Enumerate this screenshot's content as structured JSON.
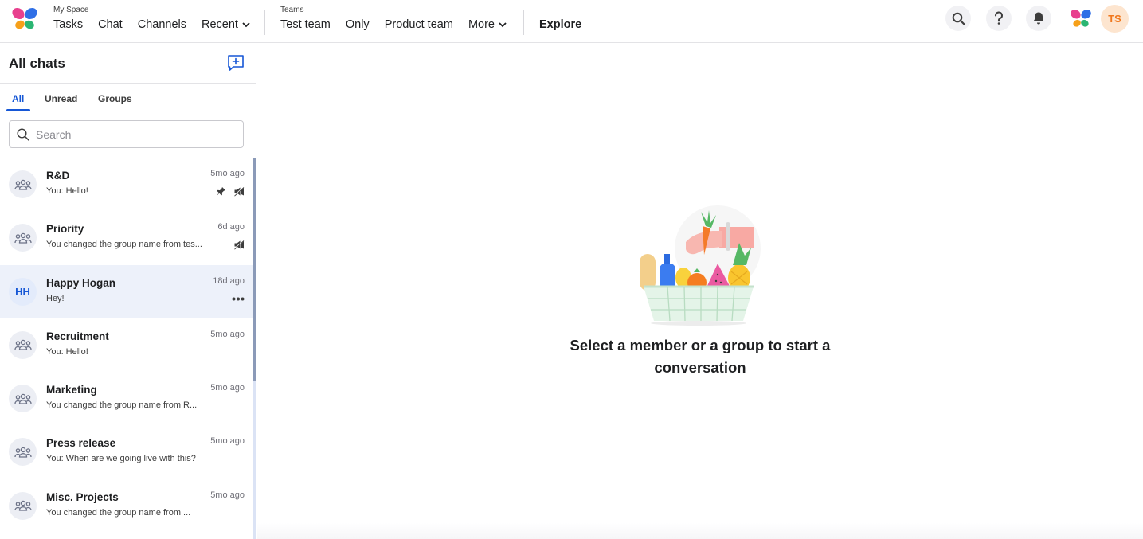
{
  "nav": {
    "myspace_label": "My Space",
    "myspace_items": [
      "Tasks",
      "Chat",
      "Channels",
      "Recent"
    ],
    "teams_label": "Teams",
    "teams_items": [
      "Test team",
      "Only",
      "Product team",
      "More"
    ],
    "explore": "Explore",
    "user_initials": "TS",
    "icons": [
      "search-icon",
      "help-icon",
      "bell-icon",
      "app-logo-icon"
    ]
  },
  "sidebar": {
    "title": "All chats",
    "tabs": [
      "All",
      "Unread",
      "Groups"
    ],
    "active_tab": "All",
    "search_placeholder": "Search",
    "chats": [
      {
        "name": "R&D",
        "preview": "You: Hello!",
        "time": "5mo ago",
        "avatar": "group",
        "icons": [
          "pin",
          "mute"
        ]
      },
      {
        "name": "Priority",
        "preview": "You changed the group name from tes...",
        "time": "6d ago",
        "avatar": "group",
        "icons": [
          "mute"
        ]
      },
      {
        "name": "Happy Hogan",
        "preview": "Hey!",
        "time": "18d ago",
        "avatar": "HH",
        "icons": [
          "more"
        ],
        "selected": true
      },
      {
        "name": "Recruitment",
        "preview": "You: Hello!",
        "time": "5mo ago",
        "avatar": "group",
        "icons": []
      },
      {
        "name": "Marketing",
        "preview": "You changed the group name from R...",
        "time": "5mo ago",
        "avatar": "group",
        "icons": []
      },
      {
        "name": "Press release",
        "preview": "You: When are we going live with this?",
        "time": "5mo ago",
        "avatar": "group",
        "icons": []
      },
      {
        "name": "Misc. Projects",
        "preview": "You changed the group name from ...",
        "time": "5mo ago",
        "avatar": "group",
        "icons": []
      }
    ]
  },
  "main": {
    "empty_line1": "Select a member or a group to start a",
    "empty_line2": "conversation"
  },
  "colors": {
    "accent": "#1657d6",
    "selected_row": "#edf1fa",
    "avatar_ts": "#fde5cf"
  }
}
